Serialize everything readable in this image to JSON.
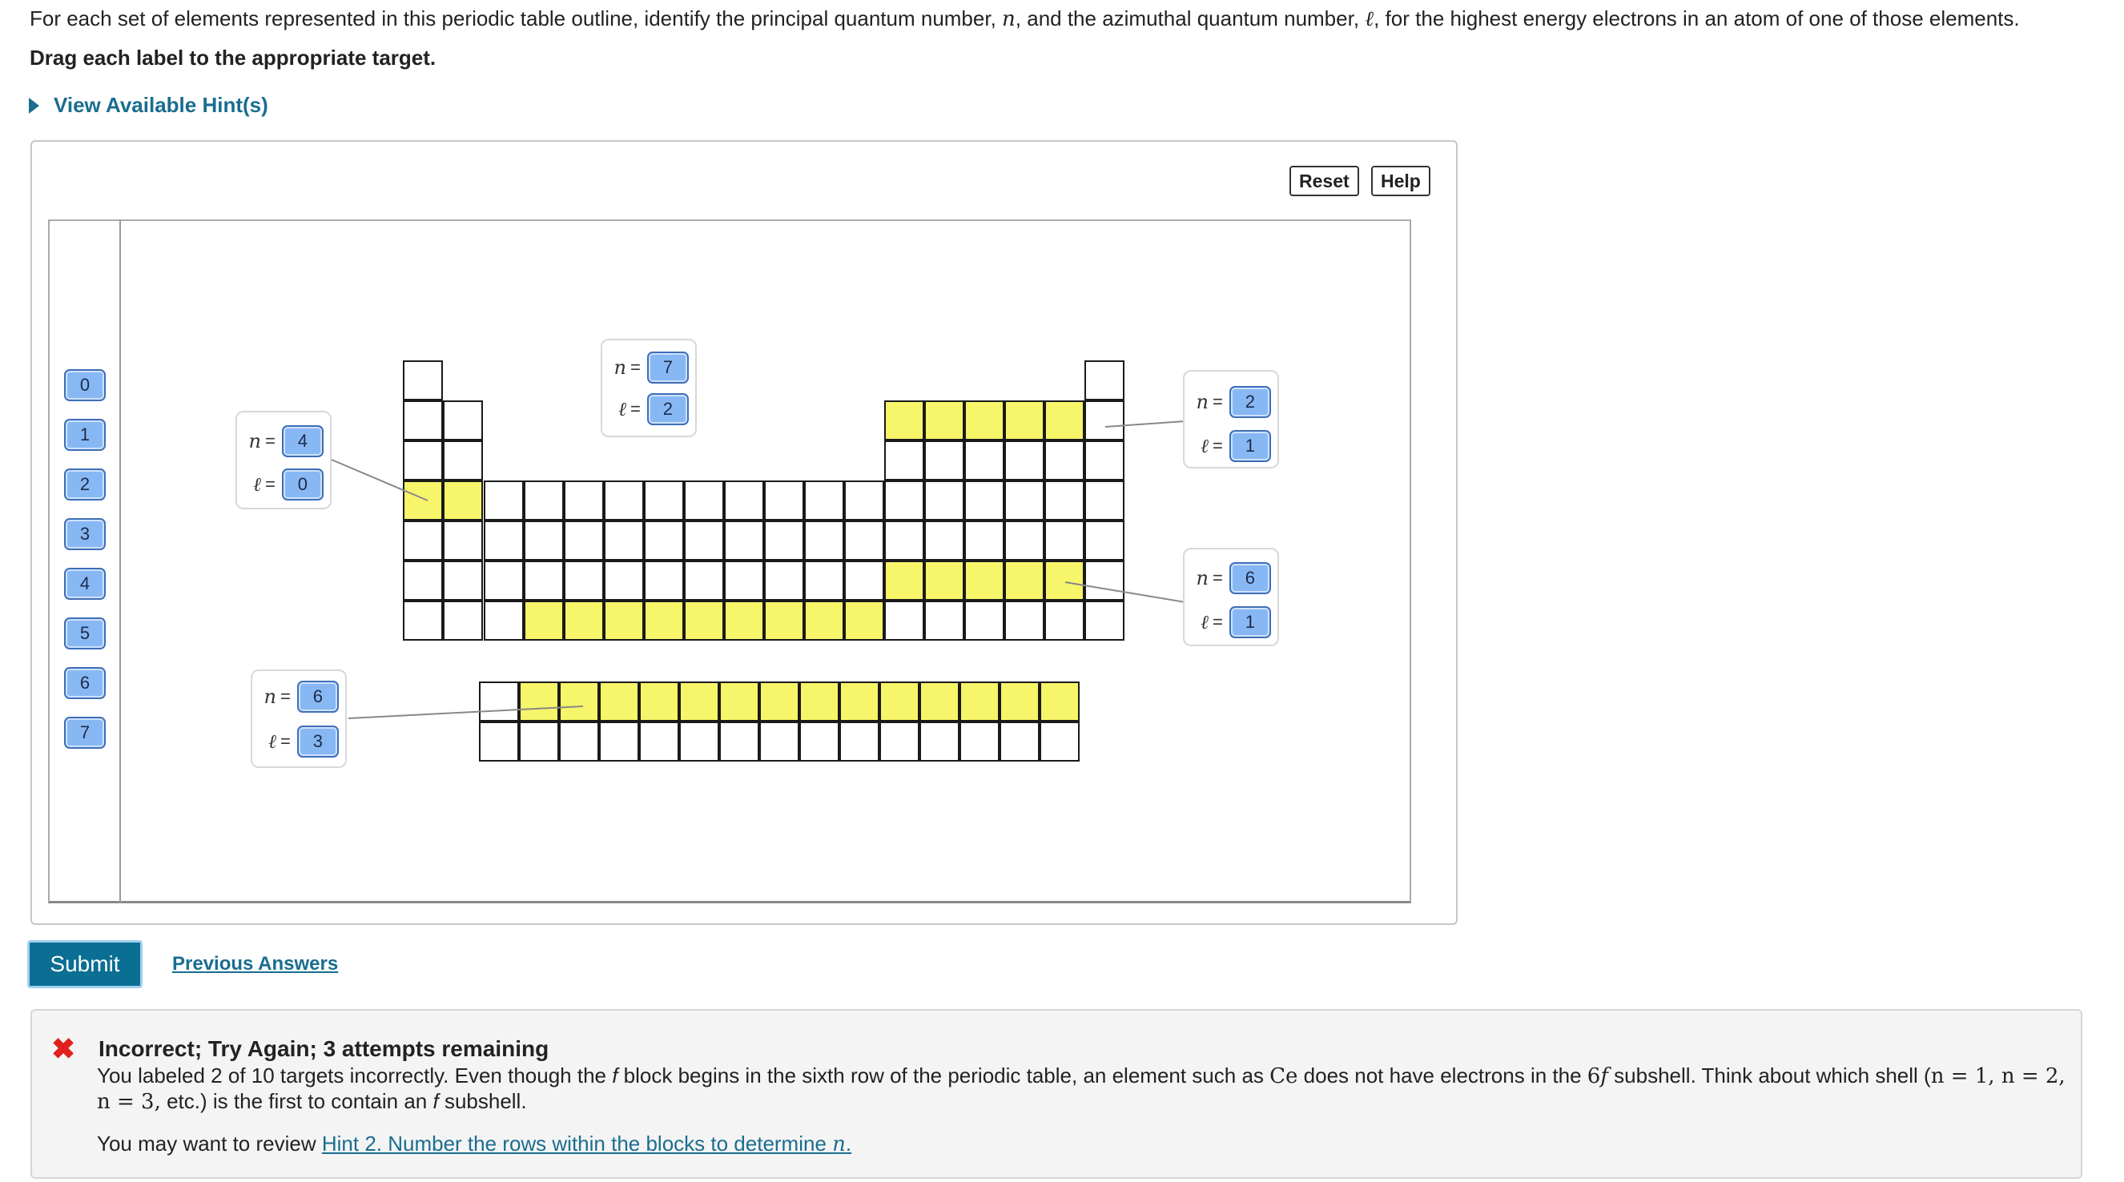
{
  "question": {
    "part1": "For each set of elements represented in this periodic table outline, identify the principal quantum number, ",
    "n_sym": "n",
    "part2": ", and the azimuthal quantum number, ",
    "l_sym": "ℓ",
    "part3": ", for the highest energy electrons in an atom of one of those elements."
  },
  "instruction": "Drag each label to the appropriate target.",
  "hint_toggle": "View Available Hint(s)",
  "toolbar": {
    "reset": "Reset",
    "help": "Help"
  },
  "chips": [
    "0",
    "1",
    "2",
    "3",
    "4",
    "5",
    "6",
    "7"
  ],
  "label_groups": [
    {
      "n_var": "n",
      "l_var": "ℓ",
      "eq": "=",
      "n_value": "4",
      "l_value": "0"
    },
    {
      "n_var": "n",
      "l_var": "ℓ",
      "eq": "=",
      "n_value": "7",
      "l_value": "2"
    },
    {
      "n_var": "n",
      "l_var": "ℓ",
      "eq": "=",
      "n_value": "2",
      "l_value": "1"
    },
    {
      "n_var": "n",
      "l_var": "ℓ",
      "eq": "=",
      "n_value": "6",
      "l_value": "1"
    },
    {
      "n_var": "n",
      "l_var": "ℓ",
      "eq": "=",
      "n_value": "6",
      "l_value": "3"
    }
  ],
  "submit": "Submit",
  "previous_answers": "Previous Answers",
  "feedback": {
    "title": "Incorrect; Try Again; 3 attempts remaining",
    "l1_a": "You labeled 2 of 10 targets incorrectly. Even though the ",
    "l1_f1": "f",
    "l1_b": " block begins in the sixth row of the periodic table, an element such as ",
    "l1_ce": "Ce",
    "l1_c": " does not have electrons in the ",
    "l1_6": "6",
    "l1_f2": "f",
    "l1_d": " subshell. Think about which shell (",
    "l1_e": "n = 1, n = 2,",
    "l2_a": "n = 3,",
    "l2_b": " etc.) is the first to contain an ",
    "l2_f": "f",
    "l2_c": " subshell.",
    "l3_a": "You may want to review ",
    "l3_link": "Hint 2. Number the rows within the blocks to determine ",
    "l3_n": "n",
    "l3_dot": "."
  },
  "colors": {
    "highlight": "#f7f569",
    "chip": "#88b8f4",
    "link": "#1a6d8f",
    "submit": "#0b6f94",
    "error": "#e0201a"
  }
}
